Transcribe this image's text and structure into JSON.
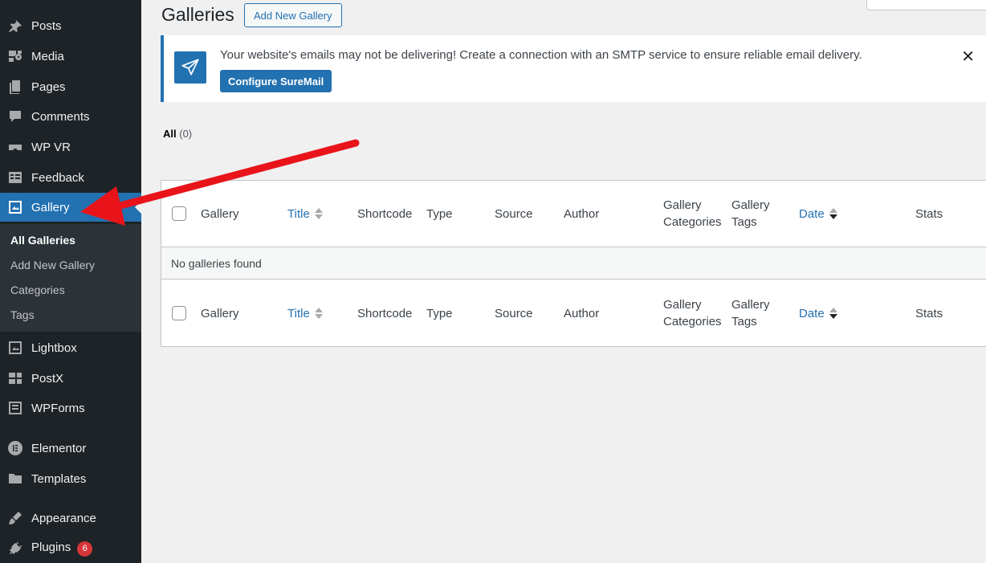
{
  "sidebar": {
    "items": [
      {
        "label": "Posts",
        "icon": "pin-icon"
      },
      {
        "label": "Media",
        "icon": "media-icon"
      },
      {
        "label": "Pages",
        "icon": "pages-icon"
      },
      {
        "label": "Comments",
        "icon": "comment-icon"
      },
      {
        "label": "WP VR",
        "icon": "vr-headset-icon"
      },
      {
        "label": "Feedback",
        "icon": "feedback-icon"
      },
      {
        "label": "Gallery",
        "icon": "gallery-icon"
      },
      {
        "label": "Lightbox",
        "icon": "lightbox-icon"
      },
      {
        "label": "PostX",
        "icon": "postx-icon"
      },
      {
        "label": "WPForms",
        "icon": "wpforms-icon"
      },
      {
        "label": "Elementor",
        "icon": "elementor-icon"
      },
      {
        "label": "Templates",
        "icon": "folder-icon"
      },
      {
        "label": "Appearance",
        "icon": "brush-icon"
      },
      {
        "label": "Plugins",
        "icon": "plug-icon",
        "badge": "6"
      }
    ],
    "submenu": [
      {
        "label": "All Galleries"
      },
      {
        "label": "Add New Gallery"
      },
      {
        "label": "Categories"
      },
      {
        "label": "Tags"
      }
    ]
  },
  "header": {
    "title": "Galleries",
    "add_new_label": "Add New Gallery"
  },
  "notice": {
    "text": "Your website's emails may not be delivering! Create a connection with an SMTP service to ensure reliable email delivery.",
    "button_label": "Configure SureMail",
    "close_glyph": "✕"
  },
  "views": {
    "all_label": "All",
    "all_count": "(0)"
  },
  "table": {
    "columns": [
      {
        "label": "Gallery"
      },
      {
        "label": "Title"
      },
      {
        "label": "Shortcode"
      },
      {
        "label": "Type"
      },
      {
        "label": "Source"
      },
      {
        "label": "Author"
      },
      {
        "label": "Gallery Categories"
      },
      {
        "label": "Gallery Tags"
      },
      {
        "label": "Date"
      },
      {
        "label": "Stats"
      }
    ],
    "empty_text": "No galleries found"
  },
  "colors": {
    "sidebar_bg": "#1d2327",
    "accent": "#2271b1",
    "annotation_arrow": "#e8141a",
    "badge": "#d63638"
  }
}
